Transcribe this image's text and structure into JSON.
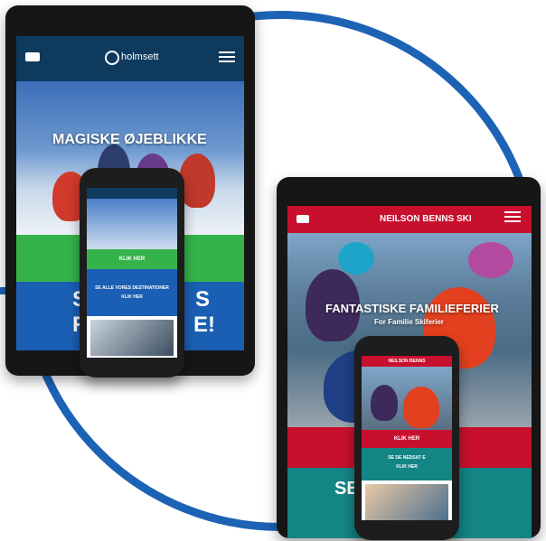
{
  "left_site": {
    "logo": "holmsett",
    "hero_title": "MAGISKE ØJEBLIKKE",
    "green_bar_label": "",
    "blue_bar_text_1": "S",
    "blue_bar_text_2": "S",
    "blue_bar_text_3": "R",
    "blue_bar_text_4": "E!",
    "phone_green_btn": "KLIK HER",
    "phone_blue_text": "SE ALLE VORES DESTINATIONER",
    "phone_blue_sub": "KLIK HER"
  },
  "right_site": {
    "logo": "NEILSON BENNS SKI",
    "hero_title": "FANTASTISKE FAMILIEFERIER",
    "hero_subtitle": "For Familie Skiferier",
    "teal_text": "SE",
    "phone_red_btn": "KLIK HER",
    "phone_teal_text": "SE DE NEDSAT E",
    "phone_teal_sub": "KLIK HER",
    "phone_header": "NEILSON BENNS"
  },
  "colors": {
    "ring": "#1c63b5",
    "left_header": "#0e3a5e",
    "left_green": "#35b34a",
    "left_blue": "#1b5fb4",
    "right_red": "#c8102e",
    "right_teal": "#138585"
  },
  "icons": [
    "bed-icon",
    "menu-icon"
  ]
}
